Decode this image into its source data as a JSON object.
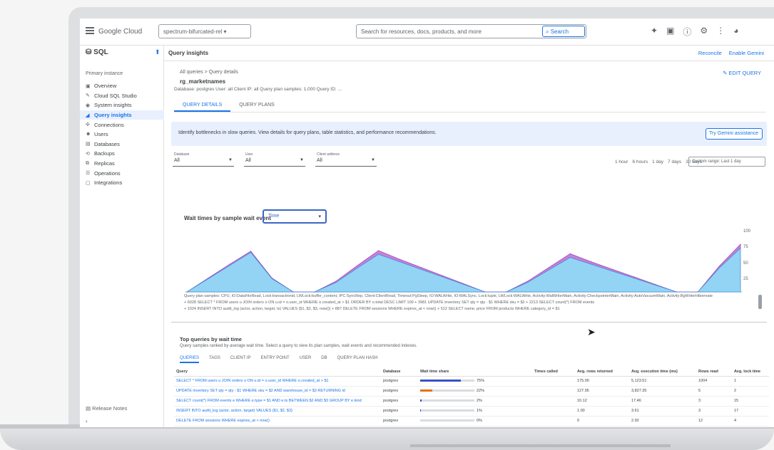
{
  "topbar": {
    "brand": "Google Cloud",
    "project": "spectrum-bifurcated-rel ▾",
    "search_placeholder": "Search for resources, docs, products, and more",
    "search_button": "Search",
    "icons": [
      "add-icon",
      "terminal-icon",
      "help-icon",
      "settings-icon",
      "more-icon",
      "avatar"
    ]
  },
  "sidebar": {
    "title": "SQL",
    "section": "Primary instance",
    "items": [
      {
        "label": "Overview",
        "icon": "▣"
      },
      {
        "label": "Cloud SQL Studio",
        "icon": "✎"
      },
      {
        "label": "System insights",
        "icon": "◉"
      },
      {
        "label": "Query insights",
        "icon": "◢",
        "active": true
      },
      {
        "label": "Connections",
        "icon": "✣"
      },
      {
        "label": "Users",
        "icon": "☻"
      },
      {
        "label": "Databases",
        "icon": "▤"
      },
      {
        "label": "Backups",
        "icon": "⟲"
      },
      {
        "label": "Replicas",
        "icon": "⧉"
      },
      {
        "label": "Operations",
        "icon": "☰"
      },
      {
        "label": "Integrations",
        "icon": "▢"
      }
    ],
    "release_notes": "Release Notes",
    "collapse": "‹"
  },
  "main": {
    "page_title": "Query insights",
    "head_links": [
      "Reconcile",
      "Enable Gemini"
    ],
    "breadcrumb": "All queries > Query details",
    "subtitle": "rg_marketnames",
    "meta": "Database: postgres   User: all   Client IP: all   Query plan samples: 1,000   Query ID: ...",
    "edit_link": "✎ EDIT QUERY",
    "tabs": [
      "QUERY DETAILS",
      "QUERY PLANS"
    ],
    "banner": {
      "text": "Identify bottlenecks in slow queries. View details for query plans, table statistics, and performance recommendations.",
      "button": "Try Gemini assistance"
    },
    "filters": [
      {
        "label": "Database",
        "value": "All"
      },
      {
        "label": "User",
        "value": "All"
      },
      {
        "label": "Client address",
        "value": "All"
      }
    ],
    "ranges": [
      "1 hour",
      "6 hours",
      "1 day",
      "7 days",
      "30 days"
    ],
    "range_select": "Custom range: Last 1 day",
    "chart_label": "Wait times by sample wait event",
    "chart_select": "Time",
    "chart_select_arrow": "▾",
    "y_ticks": [
      "100",
      "75",
      "50",
      "25"
    ],
    "legend_lines": [
      "Query plan samples: CPU, IO:DataFileRead, Lock:transactionid, LWLock:buffer_content, IPC:SyncRep, Client:ClientRead, Timeout:PgSleep, IO:WALWrite, IO:WALSync, Lock:tuple, LWLock:WALWrite, Activity:WalWriterMain, Activity:CheckpointerMain, Activity:AutoVacuumMain, Activity:BgWriterHibernate",
      "+ 6028 SELECT * FROM users u JOIN orders o ON u.id = o.user_id WHERE o.created_at > $1 ORDER BY o.total DESC LIMIT 100 + 3981 UPDATE inventory SET qty = qty - $1 WHERE sku = $2 + 2213 SELECT count(*) FROM events",
      "+ 1024 INSERT INTO audit_log (actor, action, target, ts) VALUES ($1, $2, $3, now()) + 887 DELETE FROM sessions WHERE expires_at < now() + 512 SELECT name, price FROM products WHERE category_id = $1"
    ],
    "table": {
      "title": "Top queries by wait time",
      "subtitle": "Query samples ranked by average wait time. Select a query to view its plan samples, wait events and recommended indexes.",
      "tabs": [
        "QUERIES",
        "TAGS",
        "CLIENT IP",
        "ENTRY POINT",
        "USER",
        "DB",
        "QUERY PLAN HASH"
      ],
      "headers": [
        "Query",
        "Database",
        "Wait time share",
        "Times called",
        "Avg. rows returned",
        "Avg. execution time (ms)",
        "Rows read",
        "Avg. lock time"
      ],
      "rows": [
        {
          "query": "SELECT * FROM users u JOIN orders o ON u.id = o.user_id WHERE o.created_at > $1",
          "db": "postgres",
          "share": 0.75,
          "color": "#3b4fc4",
          "pct": "75%",
          "called": "",
          "rows_ret": "175.00",
          "exec": "5,123.51",
          "read": "1004",
          "lock": "1"
        },
        {
          "query": "UPDATE inventory SET qty = qty - $1 WHERE sku = $2 AND warehouse_id = $3 RETURNING id",
          "db": "postgres",
          "share": 0.22,
          "color": "#e8710a",
          "pct": "22%",
          "called": "",
          "rows_ret": "127.95",
          "exec": "3,827.35",
          "read": "5",
          "lock": "2"
        },
        {
          "query": "SELECT count(*) FROM events e WHERE e.type = $1 AND e.ts BETWEEN $2 AND $3 GROUP BY e.kind",
          "db": "postgres",
          "share": 0.02,
          "color": "#3b4fc4",
          "pct": "2%",
          "called": "",
          "rows_ret": "10.12",
          "exec": "17.46",
          "read": "3",
          "lock": "15"
        },
        {
          "query": "INSERT INTO audit_log (actor, action, target) VALUES ($1, $2, $3)",
          "db": "postgres",
          "share": 0.01,
          "color": "#3b4fc4",
          "pct": "1%",
          "called": "",
          "rows_ret": "1.00",
          "exec": "3.61",
          "read": "3",
          "lock": "17"
        },
        {
          "query": "DELETE FROM sessions WHERE expires_at < now()",
          "db": "postgres",
          "share": 0.0,
          "color": "#3b4fc4",
          "pct": "0%",
          "called": "",
          "rows_ret": "0",
          "exec": "2.92",
          "read": "12",
          "lock": "4"
        }
      ]
    }
  },
  "chart_data": {
    "type": "area",
    "x": [
      0,
      1,
      2,
      3,
      4,
      5,
      6,
      7,
      8,
      9,
      10,
      11,
      12,
      13,
      14,
      15,
      16,
      17,
      18,
      19,
      20,
      21,
      22,
      23,
      24,
      25,
      26
    ],
    "series": [
      {
        "color": "#93d4f5",
        "values": [
          0,
          21,
          42,
          63,
          21,
          0,
          0,
          15,
          38,
          60,
          48,
          36,
          24,
          12,
          0,
          0,
          15,
          35,
          55,
          44,
          33,
          22,
          11,
          0,
          0,
          38,
          70
        ]
      },
      {
        "color": "#c77fdb",
        "values": [
          0,
          1,
          2,
          2,
          1,
          0,
          0,
          2,
          4,
          6,
          4,
          3,
          2,
          1,
          0,
          0,
          2,
          4,
          6,
          4,
          3,
          2,
          1,
          0,
          0,
          3,
          6
        ]
      }
    ],
    "ylim": [
      0,
      100
    ],
    "yticks": [
      25,
      50,
      75,
      100
    ],
    "grid": false
  }
}
